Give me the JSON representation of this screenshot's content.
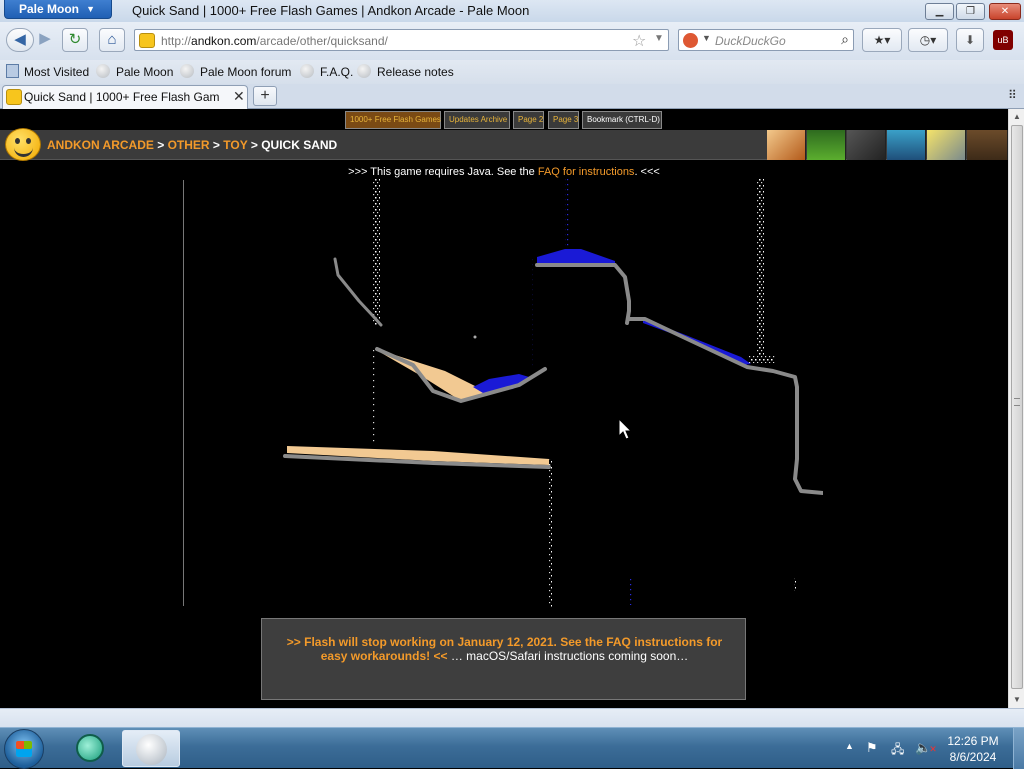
{
  "window": {
    "app_menu_label": "Pale Moon",
    "title": "Quick Sand | 1000+ Free Flash Games | Andkon Arcade - Pale Moon"
  },
  "navbar": {
    "url_prefix": "http://",
    "url_host": "andkon.com",
    "url_path": "/arcade/other/quicksand/",
    "search_placeholder": "DuckDuckGo"
  },
  "bookmarks": [
    {
      "label": "Most Visited"
    },
    {
      "label": "Pale Moon"
    },
    {
      "label": "Pale Moon forum"
    },
    {
      "label": "F.A.Q."
    },
    {
      "label": "Release notes"
    }
  ],
  "tab": {
    "title": "Quick Sand | 1000+ Free Flash Games | Andkon Arcade"
  },
  "site": {
    "top_nav": [
      {
        "label": "1000+ Free Flash Games"
      },
      {
        "label": "Updates Archive"
      },
      {
        "label": "Page 2"
      },
      {
        "label": "Page 3"
      },
      {
        "label": "Bookmark (CTRL-D)"
      }
    ],
    "breadcrumb": {
      "home": "ANDKON ARCADE",
      "category": "OTHER",
      "subcategory": "TOY",
      "current": "QUICK SAND",
      "separator": ">"
    },
    "java_notice": {
      "prefix": ">>> This game requires Java. See the ",
      "link": "FAQ for instructions",
      "suffix": ". <<<"
    },
    "flash_notice": {
      "warning": ">> Flash will stop working on January 12, 2021. See the FAQ instructions for easy workarounds! <<",
      "extra": " … macOS/Safari instructions coming soon…"
    }
  },
  "game": {
    "colors": {
      "background": "#000000",
      "wall": "#8a8a8a",
      "sand": "#f2c992",
      "water": "#1a1ad6",
      "dust": "#ffffff"
    }
  },
  "taskbar": {
    "time": "12:26 PM",
    "date": "8/6/2024"
  }
}
